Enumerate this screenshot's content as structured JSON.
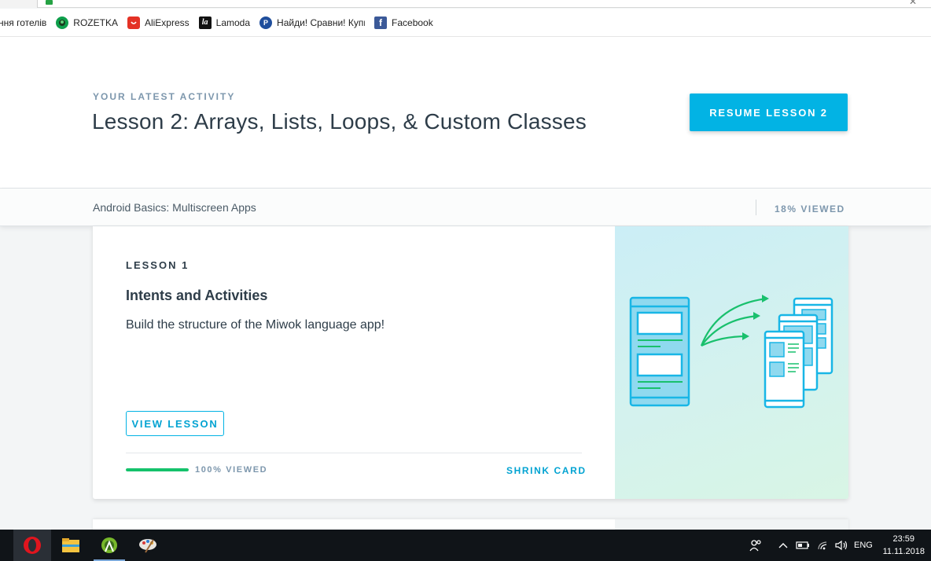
{
  "browser": {
    "bookmarks": [
      {
        "label": "ння готелів",
        "icon": "hotel-icon"
      },
      {
        "label": "ROZETKA",
        "icon": "rozetka-icon",
        "color": "#0e9f4b"
      },
      {
        "label": "AliExpress",
        "icon": "aliexpress-icon",
        "color": "#e43225"
      },
      {
        "label": "Lamoda",
        "icon": "lamoda-icon",
        "color": "#111111"
      },
      {
        "label": "Найди! Сравни! Купи",
        "icon": "price-compare-icon",
        "color": "#1f4e9c"
      },
      {
        "label": "Facebook",
        "icon": "facebook-icon",
        "color": "#3b5998"
      }
    ]
  },
  "activity": {
    "kicker": "YOUR LATEST ACTIVITY",
    "title": "Lesson 2: Arrays, Lists, Loops, & Custom Classes",
    "resume_label": "RESUME LESSON 2"
  },
  "course": {
    "name": "Android Basics: Multiscreen Apps",
    "viewed": "18% VIEWED"
  },
  "lesson": {
    "number": "LESSON 1",
    "title": "Intents and Activities",
    "description": "Build the structure of the Miwok language app!",
    "view_label": "VIEW LESSON",
    "progress": 1.0,
    "progress_label": "100% VIEWED",
    "shrink_label": "SHRINK CARD"
  },
  "taskbar": {
    "apps": [
      "opera-icon",
      "file-explorer-icon",
      "android-studio-icon",
      "paint-icon"
    ],
    "language": "ENG",
    "time": "23:59",
    "date": "11.11.2018"
  },
  "colors": {
    "accent": "#02b3e4",
    "progress": "#15c26b",
    "muted": "#7d97ad",
    "text": "#2e3d49"
  }
}
